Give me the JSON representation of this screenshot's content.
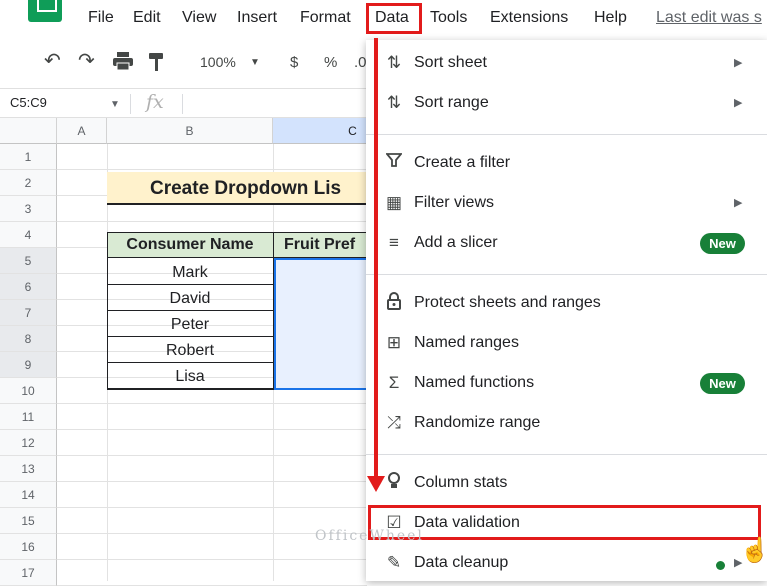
{
  "menubar": {
    "items": [
      "File",
      "Edit",
      "View",
      "Insert",
      "Format",
      "Data",
      "Tools",
      "Extensions",
      "Help"
    ],
    "last_edit": "Last edit was s"
  },
  "toolbar": {
    "zoom": "100%",
    "currency": "$",
    "percent": "%",
    "decimal": ".0"
  },
  "formula_bar": {
    "name_box": "C5:C9",
    "fx": "fx"
  },
  "sheet": {
    "columns": [
      "A",
      "B",
      "C"
    ],
    "rows": [
      "1",
      "2",
      "3",
      "4",
      "5",
      "6",
      "7",
      "8",
      "9",
      "10",
      "11",
      "12",
      "13",
      "14",
      "15",
      "16",
      "17"
    ],
    "title": "Create Dropdown Lis",
    "headers": [
      "Consumer Name",
      "Fruit Pref"
    ],
    "names": [
      "Mark",
      "David",
      "Peter",
      "Robert",
      "Lisa"
    ]
  },
  "data_menu": {
    "items": [
      {
        "label": "Sort sheet",
        "icon": "sort-icon",
        "submenu": true
      },
      {
        "label": "Sort range",
        "icon": "sort-icon",
        "submenu": true
      },
      {
        "label": "Create a filter",
        "icon": "filter-icon"
      },
      {
        "label": "Filter views",
        "icon": "filter-views-icon",
        "submenu": true
      },
      {
        "label": "Add a slicer",
        "icon": "slicer-icon",
        "badge": "New"
      },
      {
        "label": "Protect sheets and ranges",
        "icon": "lock-icon"
      },
      {
        "label": "Named ranges",
        "icon": "named-ranges-icon"
      },
      {
        "label": "Named functions",
        "icon": "sigma-icon",
        "badge": "New"
      },
      {
        "label": "Randomize range",
        "icon": "shuffle-icon"
      },
      {
        "label": "Column stats",
        "icon": "lightbulb-icon"
      },
      {
        "label": "Data validation",
        "icon": "data-validation-icon"
      },
      {
        "label": "Data cleanup",
        "icon": "magic-wand-icon",
        "submenu": true
      }
    ]
  },
  "watermark": "OfficeWheel",
  "colors": {
    "accent_green": "#188038",
    "highlight_red": "#e21b1b",
    "header_fill": "#d9ead3",
    "title_fill": "#fff2cc"
  }
}
